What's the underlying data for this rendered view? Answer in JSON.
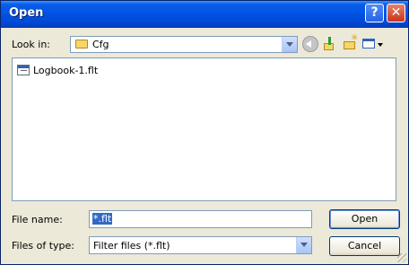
{
  "window": {
    "title": "Open",
    "help_icon": "help-icon",
    "close_icon": "close-icon"
  },
  "toolbar": {
    "look_in_label": "Look in:",
    "look_in_value": "Cfg",
    "icons": [
      "back-icon",
      "up-folder-icon",
      "new-folder-icon",
      "views-menu-icon"
    ]
  },
  "file_list": {
    "items": [
      {
        "name": "Logbook-1.flt",
        "icon": "flight-file-icon"
      }
    ]
  },
  "form": {
    "file_name_label": "File name:",
    "file_name_value": "*.flt",
    "files_of_type_label": "Files of type:",
    "files_of_type_value": "Filter files (*.flt)",
    "open_button": "Open",
    "cancel_button": "Cancel"
  },
  "colors": {
    "title_bar": "#0055e5",
    "dialog_bg": "#ece9d8",
    "selection": "#316ac5"
  }
}
